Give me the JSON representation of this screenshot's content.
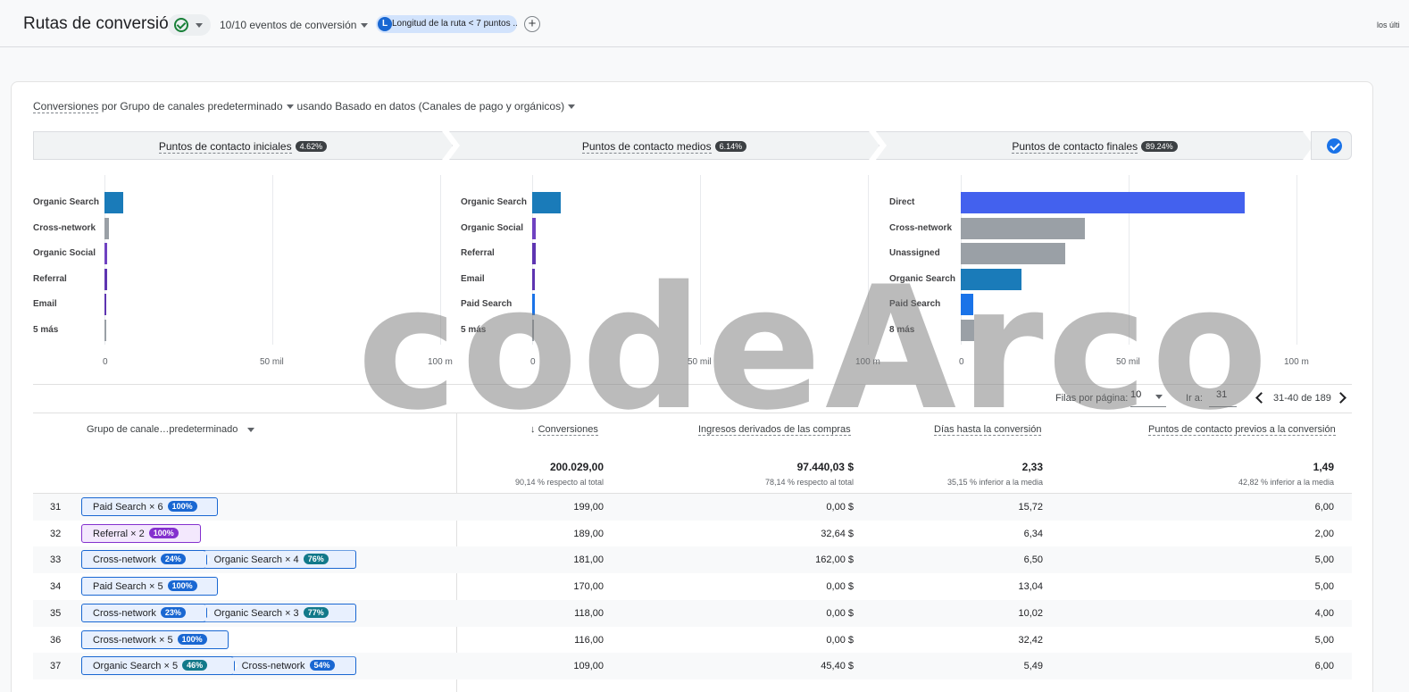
{
  "header": {
    "title": "Rutas de conversión",
    "events_label": "10/10 eventos de conversión",
    "filter_letter": "L",
    "filter_label": "Longitud de la ruta < 7 puntos ...",
    "add_label": "+",
    "date_label": "los últi"
  },
  "dimensions": {
    "metric": "Conversiones",
    "by": "por",
    "dimension": "Grupo de canales predeterminado",
    "using": "usando",
    "model": "Basado en datos (Canales de pago y orgánicos)"
  },
  "stages": [
    {
      "label": "Puntos de contacto iniciales",
      "pct": "4.62%"
    },
    {
      "label": "Puntos de contacto medios",
      "pct": "6.14%"
    },
    {
      "label": "Puntos de contacto finales",
      "pct": "89.24%"
    }
  ],
  "chart_data": [
    {
      "type": "bar",
      "orientation": "horizontal",
      "stage": "Puntos de contacto iniciales",
      "categories": [
        "Organic Search",
        "Cross-network",
        "Organic Social",
        "Referral",
        "Email",
        "5 más"
      ],
      "values": [
        5700,
        1300,
        900,
        700,
        600,
        400
      ],
      "colors": [
        "#1a7bb9",
        "#9aa0a6",
        "#6f42c1",
        "#5e35b1",
        "#5e35b1",
        "#9aa0a6"
      ],
      "xticks": [
        "0",
        "50 mil",
        "100 m"
      ],
      "xlim": [
        0,
        100000
      ]
    },
    {
      "type": "bar",
      "orientation": "horizontal",
      "stage": "Puntos de contacto medios",
      "categories": [
        "Organic Search",
        "Organic Social",
        "Referral",
        "Email",
        "Paid Search",
        "5 más"
      ],
      "values": [
        8600,
        1100,
        1000,
        900,
        700,
        600
      ],
      "colors": [
        "#1a7bb9",
        "#6f42c1",
        "#5e35b1",
        "#5e35b1",
        "#1a73e8",
        "#9aa0a6"
      ],
      "xticks": [
        "0",
        "50 mil",
        "100 m"
      ],
      "xlim": [
        0,
        100000
      ]
    },
    {
      "type": "bar",
      "orientation": "horizontal",
      "stage": "Puntos de contacto finales",
      "categories": [
        "Direct",
        "Cross-network",
        "Unassigned",
        "Organic Search",
        "Paid Search",
        "8 más"
      ],
      "values": [
        84700,
        37000,
        31000,
        18200,
        3600,
        4000
      ],
      "colors": [
        "#4361ee",
        "#9aa0a6",
        "#9aa0a6",
        "#1a7bb9",
        "#1a73e8",
        "#9aa0a6"
      ],
      "xticks": [
        "0",
        "50 mil",
        "100 m"
      ],
      "xlim": [
        0,
        100000
      ]
    }
  ],
  "pagination": {
    "rows_label": "Filas por página:",
    "rows_value": "10",
    "goto_label": "Ir a:",
    "goto_value": "31",
    "range": "31-40 de 189"
  },
  "table": {
    "col_dimension": "Grupo de canale…predeterminado",
    "col_conversions": "Conversiones",
    "col_revenue": "Ingresos derivados de las compras",
    "col_days": "Días hasta la conversión",
    "col_touchpoints": "Puntos de contacto previos a la conversión",
    "totals": {
      "conversions": "200.029,00",
      "conversions_sub": "90,14 % respecto al total",
      "revenue": "97.440,03 $",
      "revenue_sub": "78,14 % respecto al total",
      "days": "2,33",
      "days_sub": "35,15 % inferior a la media",
      "touchpoints": "1,49",
      "touchpoints_sub": "42,82 % inferior a la media"
    },
    "rows": [
      {
        "n": "31",
        "path": [
          {
            "label": "Paid Search × 6",
            "pct": "100%"
          }
        ],
        "conv": "199,00",
        "rev": "0,00 $",
        "days": "15,72",
        "tp": "6,00"
      },
      {
        "n": "32",
        "path": [
          {
            "label": "Referral × 2",
            "pct": "100%"
          }
        ],
        "conv": "189,00",
        "rev": "32,64 $",
        "days": "6,34",
        "tp": "2,00"
      },
      {
        "n": "33",
        "path": [
          {
            "label": "Cross-network",
            "pct": "24%"
          },
          {
            "label": "Organic Search × 4",
            "pct": "76%"
          }
        ],
        "conv": "181,00",
        "rev": "162,00 $",
        "days": "6,50",
        "tp": "5,00"
      },
      {
        "n": "34",
        "path": [
          {
            "label": "Paid Search × 5",
            "pct": "100%"
          }
        ],
        "conv": "170,00",
        "rev": "0,00 $",
        "days": "13,04",
        "tp": "5,00"
      },
      {
        "n": "35",
        "path": [
          {
            "label": "Cross-network",
            "pct": "23%"
          },
          {
            "label": "Organic Search × 3",
            "pct": "77%"
          }
        ],
        "conv": "118,00",
        "rev": "0,00 $",
        "days": "10,02",
        "tp": "4,00"
      },
      {
        "n": "36",
        "path": [
          {
            "label": "Cross-network × 5",
            "pct": "100%"
          }
        ],
        "conv": "116,00",
        "rev": "0,00 $",
        "days": "32,42",
        "tp": "5,00"
      },
      {
        "n": "37",
        "path": [
          {
            "label": "Organic Search × 5",
            "pct": "46%"
          },
          {
            "label": "Cross-network",
            "pct": "54%"
          }
        ],
        "conv": "109,00",
        "rev": "45,40 $",
        "days": "5,49",
        "tp": "6,00"
      }
    ]
  },
  "watermark": "codeArco"
}
